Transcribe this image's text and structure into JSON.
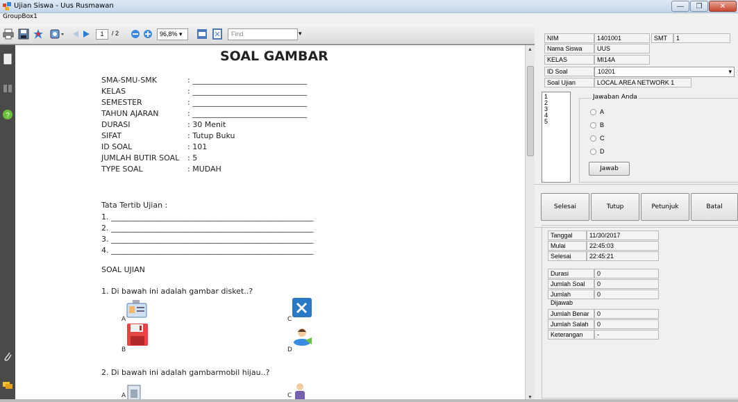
{
  "window": {
    "title": "Ujian Siswa - Uus Rusmawan",
    "groupbox": "GroupBox1"
  },
  "toolbar": {
    "page_current": "1",
    "page_total": "/ 2",
    "zoom": "96,8%",
    "find_placeholder": "Find"
  },
  "document": {
    "title": "SOAL GAMBAR",
    "info": [
      {
        "label": "SMA-SMU-SMK",
        "value": ": ______________________________"
      },
      {
        "label": "KELAS",
        "value": ": ______________________________"
      },
      {
        "label": "SEMESTER",
        "value": ": ______________________________"
      },
      {
        "label": "TAHUN AJARAN",
        "value": ": ______________________________"
      },
      {
        "label": "DURASI",
        "value": ": 30 Menit"
      },
      {
        "label": "SIFAT",
        "value": ": Tutup Buku"
      },
      {
        "label": "ID SOAL",
        "value": ": 101"
      },
      {
        "label": "JUMLAH BUTIR SOAL",
        "value": ": 5"
      },
      {
        "label": "TYPE SOAL",
        "value": ": MUDAH"
      }
    ],
    "rules_title": "Tata Tertib Ujian :",
    "rules": [
      "1. _____________________________________________________",
      "2. _____________________________________________________",
      "3. _____________________________________________________",
      "4. _____________________________________________________"
    ],
    "section": "SOAL UJIAN",
    "q1": {
      "text": "1.   Di bawah ini adalah gambar disket..?",
      "a": "A",
      "b": "B",
      "c": "C",
      "d": "D"
    },
    "q2": {
      "text": "2.   Di bawah ini adalah gambarmobil hijau..?",
      "a": "A",
      "c": "C"
    }
  },
  "student": {
    "nim_label": "NIM",
    "nim": "1401001",
    "smt_label": "SMT",
    "smt": "1",
    "nama_label": "Nama Siswa",
    "nama": "UUS",
    "kelas_label": "KELAS",
    "kelas": "MI14A",
    "idsoal_label": "ID Soal",
    "idsoal": "10201",
    "soal_label": "Soal Ujian",
    "soal": "LOCAL AREA NETWORK 1"
  },
  "answers": {
    "list": [
      "1",
      "2",
      "3",
      "4",
      "5"
    ],
    "group_title": "Jawaban Anda",
    "options": [
      "A",
      "B",
      "C",
      "D"
    ],
    "submit": "Jawab"
  },
  "actions": {
    "selesai": "Selesai",
    "tutup": "Tutup",
    "petunjuk": "Petunjuk",
    "batal": "Batal"
  },
  "stats": {
    "tanggal_label": "Tanggal",
    "tanggal": "11/30/2017",
    "mulai_label": "Mulai",
    "mulai": "22:45:03",
    "selesai_label": "Selesai",
    "selesai": "22:45:21",
    "durasi_label": "Durasi",
    "durasi": "0",
    "jsoal_label": "Jumlah Soal",
    "jsoal": "0",
    "jdijawab_label": "Jumlah Dijawab",
    "jdijawab": "0",
    "jbenar_label": "Jumlah Benar",
    "jbenar": "0",
    "jsalah_label": "Jumlah Salah",
    "jsalah": "0",
    "ket_label": "Keterangan",
    "ket": "-"
  }
}
